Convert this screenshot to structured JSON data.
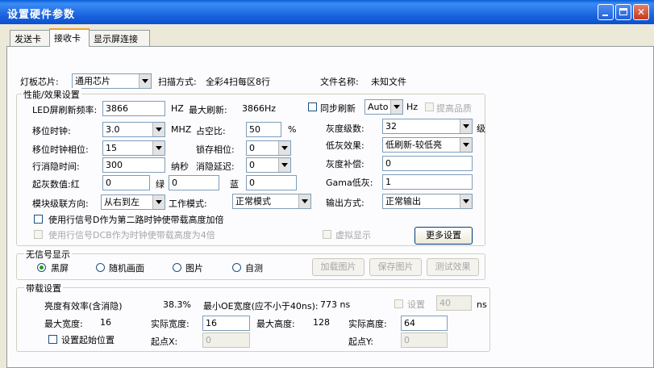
{
  "window": {
    "title": "设置硬件参数"
  },
  "tabs": [
    "发送卡",
    "接收卡",
    "显示屏连接"
  ],
  "top": {
    "chip_label": "灯板芯片:",
    "chip_value": "通用芯片",
    "scan_label": "扫描方式:",
    "scan_value": "全彩4扫每区8行",
    "file_label": "文件名称:",
    "file_value": "未知文件"
  },
  "perf": {
    "group_label": "性能/效果设置",
    "led_freq_label": "LED屏刷新频率:",
    "led_freq_value": "3866",
    "mhz_unit": "HZ",
    "max_refresh_label": "最大刷新:",
    "max_refresh_value": "3866Hz",
    "sync_refresh_label": "同步刷新",
    "sync_combo_value": "Auto",
    "hz_unit": "Hz",
    "improve_quality_label": "提高品质",
    "shift_clock_label": "移位时钟:",
    "shift_clock_value": "3.0",
    "mhz_label": "MHZ",
    "duty_label": "占空比:",
    "duty_value": "50",
    "percent": "%",
    "gray_label": "灰度级数:",
    "gray_value": "32",
    "gray_unit": "级",
    "shift_phase_label": "移位时钟相位:",
    "shift_phase_value": "15",
    "latch_phase_label": "锁存相位:",
    "latch_phase_value": "0",
    "low_gray_label": "低灰效果:",
    "low_gray_value": "低刷新-较低亮",
    "blank_time_label": "行消隐时间:",
    "blank_time_value": "300",
    "ns_label": "纳秒",
    "blank_delay_label": "消隐延迟:",
    "blank_delay_value": "0",
    "gray_comp_label": "灰度补偿:",
    "gray_comp_value": "0",
    "start_gray_label": "起灰数值:红",
    "start_red_value": "0",
    "green_label": "绿",
    "start_green_value": "0",
    "blue_label": "蓝",
    "start_blue_value": "0",
    "gamma_label": "Gama低灰:",
    "gamma_value": "1",
    "cascade_label": "模块级联方向:",
    "cascade_value": "从右到左",
    "work_mode_label": "工作模式:",
    "work_mode_value": "正常模式",
    "output_label": "输出方式:",
    "output_value": "正常输出",
    "row_d_label": "使用行信号D作为第二路时钟使带载高度加倍",
    "row_dcb_label": "使用行信号DCB作为时钟使带载高度为4倍",
    "virtual_label": "虚拟显示",
    "more_button": "更多设置"
  },
  "nosignal": {
    "group_label": "无信号显示",
    "options": [
      "黑屏",
      "随机画面",
      "图片",
      "自测"
    ],
    "selected": "黑屏",
    "load_button": "加载图片",
    "save_button": "保存图片",
    "test_button": "测试效果"
  },
  "load": {
    "group_label": "带载设置",
    "brightness_label": "亮度有效率(含消隐)",
    "brightness_value": "38.3%",
    "min_oe_label": "最小OE宽度(应不小于40ns):",
    "min_oe_value": "773 ns",
    "set_label": "设置",
    "set_value": "40",
    "set_unit": "ns",
    "max_width_label": "最大宽度:",
    "max_width_value": "16",
    "actual_width_label": "实际宽度:",
    "actual_width_value": "16",
    "max_height_label": "最大高度:",
    "max_height_value": "128",
    "actual_height_label": "实际高度:",
    "actual_height_value": "64",
    "set_start_label": "设置起始位置",
    "start_x_label": "起点X:",
    "start_x_value": "0",
    "start_y_label": "起点Y:",
    "start_y_value": "0"
  },
  "colors": {
    "title_blue": "#0a5fd8",
    "close_red": "#c4391c",
    "dialog_bg": "#ece9d8",
    "tab_accent": "#f0a030"
  }
}
